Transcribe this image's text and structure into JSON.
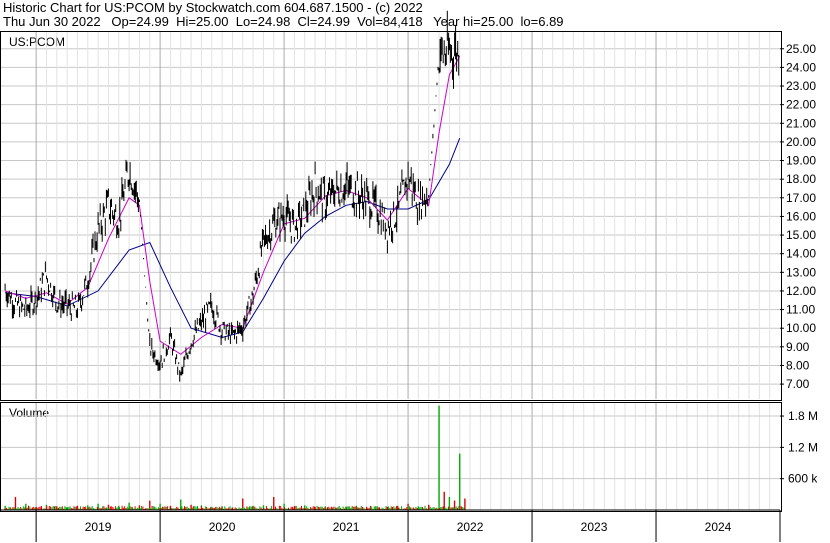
{
  "header": {
    "line1": "Historic Chart for US:PCOM by Stockwatch.com 604.687.1500 - (c) 2022",
    "line2": "Thu Jun 30 2022   Op=24.99  Hi=25.00  Lo=24.98  Cl=24.99  Vol=84,418   Year hi=25.00  lo=6.89"
  },
  "price_panel": {
    "label": "US:PCOM"
  },
  "volume_panel": {
    "label": "Volume"
  },
  "colors": {
    "price": "#000000",
    "ma_short": "#cc00cc",
    "ma_long": "#00008b",
    "vol_up": "#00aa00",
    "vol_down": "#dd0000",
    "grid": "#c8c8c8"
  },
  "chart_data": [
    {
      "type": "line",
      "title": "US:PCOM",
      "ylim": [
        6.2,
        25.9
      ],
      "yticks": [
        "25.00",
        "24.00",
        "23.00",
        "22.00",
        "21.00",
        "20.00",
        "19.00",
        "18.00",
        "17.00",
        "16.00",
        "15.00",
        "14.00",
        "13.00",
        "12.00",
        "11.00",
        "10.00",
        "9.00",
        "8.00",
        "7.00"
      ],
      "x_range": [
        "2018-10",
        "2024-12"
      ],
      "x_tick_labels": [
        "2019",
        "2020",
        "2021",
        "2022",
        "2023",
        "2024"
      ],
      "grid": true,
      "series": [
        {
          "role": "price",
          "points": [
            [
              "2018-10",
              12.1
            ],
            [
              "2018-11",
              11.3
            ],
            [
              "2018-12",
              11.0
            ],
            [
              "2019-01",
              11.6
            ],
            [
              "2019-02",
              12.8
            ],
            [
              "2019-03",
              11.4
            ],
            [
              "2019-04",
              11.2
            ],
            [
              "2019-05",
              11.0
            ],
            [
              "2019-06",
              12.6
            ],
            [
              "2019-07",
              15.3
            ],
            [
              "2019-08",
              16.6
            ],
            [
              "2019-09",
              15.8
            ],
            [
              "2019-10",
              18.6
            ],
            [
              "2019-11",
              16.8
            ],
            [
              "2019-12",
              9.0
            ],
            [
              "2020-01",
              8.2
            ],
            [
              "2020-02",
              9.5
            ],
            [
              "2020-03",
              7.4
            ],
            [
              "2020-04",
              9.3
            ],
            [
              "2020-05",
              10.3
            ],
            [
              "2020-06",
              11.2
            ],
            [
              "2020-07",
              9.9
            ],
            [
              "2020-08",
              9.6
            ],
            [
              "2020-09",
              10.1
            ],
            [
              "2020-10",
              11.8
            ],
            [
              "2020-11",
              14.6
            ],
            [
              "2020-12",
              15.6
            ],
            [
              "2021-01",
              16.1
            ],
            [
              "2021-02",
              15.4
            ],
            [
              "2021-03",
              16.2
            ],
            [
              "2021-04",
              17.6
            ],
            [
              "2021-05",
              16.8
            ],
            [
              "2021-06",
              17.4
            ],
            [
              "2021-07",
              17.6
            ],
            [
              "2021-08",
              17.2
            ],
            [
              "2021-09",
              16.9
            ],
            [
              "2021-10",
              16.4
            ],
            [
              "2021-11",
              15.4
            ],
            [
              "2021-12",
              16.3
            ],
            [
              "2022-01",
              18.2
            ],
            [
              "2022-02",
              16.8
            ],
            [
              "2022-03",
              17.2
            ],
            [
              "2022-04",
              24.7
            ],
            [
              "2022-05",
              24.8
            ],
            [
              "2022-06",
              24.99
            ]
          ]
        },
        {
          "role": "moving-average-short",
          "points": [
            [
              "2018-10",
              12.0
            ],
            [
              "2018-12",
              11.6
            ],
            [
              "2019-02",
              11.9
            ],
            [
              "2019-04",
              11.3
            ],
            [
              "2019-06",
              12.2
            ],
            [
              "2019-08",
              14.8
            ],
            [
              "2019-10",
              17.0
            ],
            [
              "2019-11",
              16.6
            ],
            [
              "2019-12",
              12.5
            ],
            [
              "2020-01",
              9.3
            ],
            [
              "2020-03",
              8.6
            ],
            [
              "2020-05",
              9.5
            ],
            [
              "2020-07",
              10.2
            ],
            [
              "2020-09",
              10.0
            ],
            [
              "2020-11",
              13.0
            ],
            [
              "2021-01",
              15.6
            ],
            [
              "2021-03",
              15.9
            ],
            [
              "2021-05",
              17.1
            ],
            [
              "2021-07",
              17.4
            ],
            [
              "2021-09",
              17.0
            ],
            [
              "2021-11",
              15.8
            ],
            [
              "2022-01",
              17.5
            ],
            [
              "2022-03",
              16.6
            ],
            [
              "2022-04",
              20.5
            ],
            [
              "2022-05",
              23.6
            ],
            [
              "2022-06",
              24.6
            ]
          ]
        },
        {
          "role": "moving-average-long",
          "points": [
            [
              "2018-10",
              11.9
            ],
            [
              "2019-01",
              11.7
            ],
            [
              "2019-04",
              11.2
            ],
            [
              "2019-07",
              12.0
            ],
            [
              "2019-10",
              14.2
            ],
            [
              "2019-12",
              14.6
            ],
            [
              "2020-02",
              12.2
            ],
            [
              "2020-04",
              10.0
            ],
            [
              "2020-07",
              9.5
            ],
            [
              "2020-09",
              9.8
            ],
            [
              "2020-11",
              11.6
            ],
            [
              "2021-01",
              13.6
            ],
            [
              "2021-03",
              15.1
            ],
            [
              "2021-05",
              16.0
            ],
            [
              "2021-07",
              16.6
            ],
            [
              "2021-09",
              16.8
            ],
            [
              "2021-11",
              16.4
            ],
            [
              "2022-01",
              16.4
            ],
            [
              "2022-03",
              16.9
            ],
            [
              "2022-05",
              18.8
            ],
            [
              "2022-06",
              20.2
            ]
          ]
        }
      ]
    },
    {
      "type": "bar",
      "title": "Volume",
      "ylim": [
        0,
        2.05
      ],
      "yticks": [
        "1.8 M",
        "1.2 M",
        "600 k"
      ],
      "series": [
        {
          "role": "volume",
          "points": [
            [
              "2018-10",
              0.08,
              "up"
            ],
            [
              "2018-11",
              0.25,
              "down"
            ],
            [
              "2018-12",
              0.12,
              "up"
            ],
            [
              "2019-01",
              0.06,
              "down"
            ],
            [
              "2019-02",
              0.1,
              "up"
            ],
            [
              "2019-03",
              0.07,
              "down"
            ],
            [
              "2019-04",
              0.05,
              "up"
            ],
            [
              "2019-05",
              0.08,
              "down"
            ],
            [
              "2019-06",
              0.09,
              "up"
            ],
            [
              "2019-07",
              0.12,
              "up"
            ],
            [
              "2019-08",
              0.1,
              "down"
            ],
            [
              "2019-09",
              0.08,
              "up"
            ],
            [
              "2019-10",
              0.14,
              "up"
            ],
            [
              "2019-11",
              0.09,
              "down"
            ],
            [
              "2019-12",
              0.18,
              "down"
            ],
            [
              "2020-01",
              0.12,
              "up"
            ],
            [
              "2020-02",
              0.08,
              "down"
            ],
            [
              "2020-03",
              0.2,
              "up"
            ],
            [
              "2020-04",
              0.1,
              "down"
            ],
            [
              "2020-05",
              0.09,
              "up"
            ],
            [
              "2020-06",
              0.06,
              "up"
            ],
            [
              "2020-07",
              0.07,
              "down"
            ],
            [
              "2020-08",
              0.05,
              "up"
            ],
            [
              "2020-09",
              0.22,
              "down"
            ],
            [
              "2020-10",
              0.08,
              "up"
            ],
            [
              "2020-11",
              0.09,
              "up"
            ],
            [
              "2020-12",
              0.25,
              "down"
            ],
            [
              "2021-01",
              0.12,
              "up"
            ],
            [
              "2021-02",
              0.07,
              "down"
            ],
            [
              "2021-03",
              0.09,
              "up"
            ],
            [
              "2021-04",
              0.06,
              "down"
            ],
            [
              "2021-05",
              0.07,
              "up"
            ],
            [
              "2021-06",
              0.05,
              "up"
            ],
            [
              "2021-07",
              0.06,
              "down"
            ],
            [
              "2021-08",
              0.08,
              "up"
            ],
            [
              "2021-09",
              0.05,
              "down"
            ],
            [
              "2021-10",
              0.07,
              "up"
            ],
            [
              "2021-11",
              0.06,
              "down"
            ],
            [
              "2021-12",
              0.08,
              "up"
            ],
            [
              "2022-01",
              0.12,
              "down"
            ],
            [
              "2022-02",
              0.07,
              "up"
            ],
            [
              "2022-03",
              0.1,
              "down"
            ],
            [
              "2022-04",
              2.0,
              "up"
            ],
            [
              "2022-04b",
              0.35,
              "down"
            ],
            [
              "2022-05",
              0.25,
              "up"
            ],
            [
              "2022-05b",
              0.18,
              "down"
            ],
            [
              "2022-06",
              1.08,
              "up"
            ],
            [
              "2022-06b",
              0.22,
              "down"
            ]
          ]
        }
      ]
    }
  ]
}
